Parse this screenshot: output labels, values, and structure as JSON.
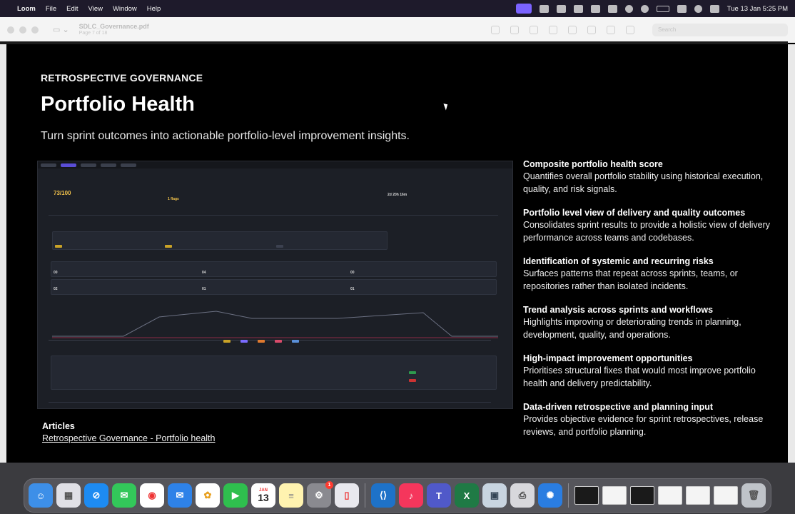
{
  "menubar": {
    "app_name": "Loom",
    "menus": [
      "File",
      "Edit",
      "View",
      "Window",
      "Help"
    ],
    "clock": "Tue 13 Jan  5:25 PM"
  },
  "window": {
    "doc_name": "SDLC_Governance.pdf",
    "page_label": "Page 7 of 18",
    "search_placeholder": "Search"
  },
  "slide": {
    "eyebrow": "RETROSPECTIVE GOVERNANCE",
    "title": "Portfolio Health",
    "subtitle": "Turn sprint outcomes into actionable portfolio-level improvement insights.",
    "dashboard": {
      "score": "73/100",
      "flags": "1 flags",
      "cycle_time": "2d 20h 16m",
      "stats": [
        "00",
        "04",
        "00",
        "02",
        "01",
        "01"
      ]
    },
    "features": [
      {
        "heading": "Composite portfolio health score",
        "desc": "Quantifies overall portfolio stability using historical execution, quality, and risk signals."
      },
      {
        "heading": "Portfolio level view of delivery and quality outcomes",
        "desc": "Consolidates sprint results to provide a holistic view of delivery performance across teams and codebases."
      },
      {
        "heading": "Identification of systemic and recurring risks",
        "desc": "Surfaces patterns that repeat across sprints, teams, or repositories rather than isolated incidents."
      },
      {
        "heading": "Trend analysis across sprints and workflows",
        "desc": "Highlights improving or deteriorating trends in planning, development, quality, and operations."
      },
      {
        "heading": "High-impact improvement opportunities",
        "desc": "Prioritises structural fixes that would most improve portfolio health and delivery predictability."
      },
      {
        "heading": "Data-driven retrospective and planning input",
        "desc": "Provides objective evidence for sprint retrospectives, release reviews, and portfolio planning."
      }
    ],
    "articles_heading": "Articles",
    "articles_link": "Retrospective Governance - Portfolio health"
  },
  "dock": {
    "calendar_month": "JAN",
    "calendar_day": "13",
    "settings_badge": "1"
  }
}
